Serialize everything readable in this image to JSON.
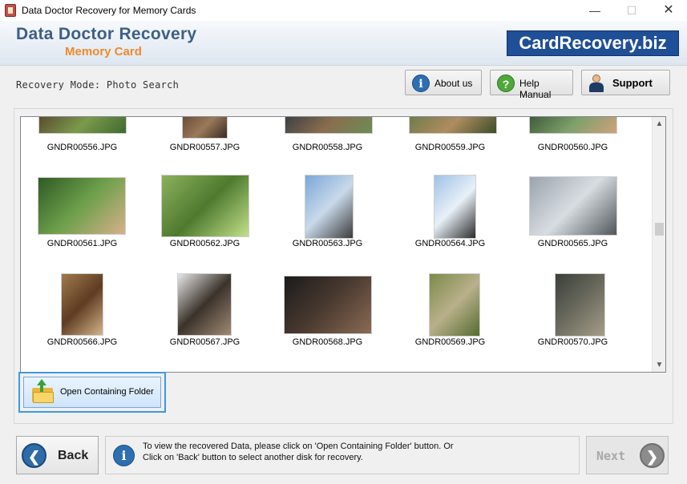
{
  "window": {
    "title": "Data Doctor Recovery for Memory Cards",
    "min_glyph": "—",
    "max_glyph": "☐",
    "close_glyph": "✕"
  },
  "header": {
    "brand_line1": "Data Doctor Recovery",
    "brand_line2": "Memory Card",
    "site_badge": "CardRecovery.biz"
  },
  "toolbar": {
    "mode": "Recovery Mode: Photo Search",
    "about_label": "About us",
    "help_label": "Help Manual",
    "support_label": "Support",
    "about_icon": "info-icon",
    "help_icon": "question-icon",
    "support_icon": "support-person-icon"
  },
  "gallery": {
    "files": [
      "GNDR00556.JPG",
      "GNDR00557.JPG",
      "GNDR00558.JPG",
      "GNDR00559.JPG",
      "GNDR00560.JPG",
      "GNDR00561.JPG",
      "GNDR00562.JPG",
      "GNDR00563.JPG",
      "GNDR00564.JPG",
      "GNDR00565.JPG",
      "GNDR00566.JPG",
      "GNDR00567.JPG",
      "GNDR00568.JPG",
      "GNDR00569.JPG",
      "GNDR00570.JPG"
    ],
    "scroll_up_glyph": "▲",
    "scroll_down_glyph": "▼"
  },
  "actions": {
    "open_folder_label": "Open Containing Folder"
  },
  "footer": {
    "back_label": "Back",
    "next_label": "Next",
    "back_glyph": "❮",
    "next_glyph": "❯",
    "info_line1": "To view the recovered Data, please click on 'Open Containing Folder' button. Or",
    "info_line2": "Click on 'Back' button to select another disk for recovery."
  },
  "colors": {
    "brand_blue": "#3d5f86",
    "brand_orange": "#f08a2c",
    "badge_blue": "#1f4f96",
    "focus_blue": "#3e98e2"
  }
}
